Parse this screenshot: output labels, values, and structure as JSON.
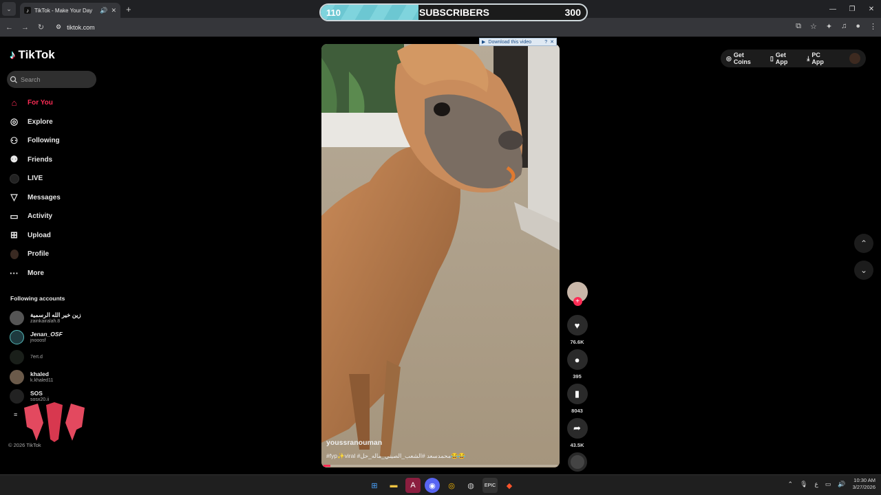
{
  "browser": {
    "tab_title": "TikTok - Make Your Day",
    "url": "tiktok.com"
  },
  "overlay": {
    "current": "110",
    "label": "SUBSCRIBERS",
    "goal": "300",
    "progress_fraction": 0.367
  },
  "sidebar": {
    "brand": "TikTok",
    "search_placeholder": "Search",
    "nav": [
      {
        "label": "For You",
        "icon": "home-icon",
        "active": true
      },
      {
        "label": "Explore",
        "icon": "compass-icon"
      },
      {
        "label": "Following",
        "icon": "following-icon"
      },
      {
        "label": "Friends",
        "icon": "friends-icon"
      },
      {
        "label": "LIVE",
        "icon": "live-icon"
      },
      {
        "label": "Messages",
        "icon": "messages-icon"
      },
      {
        "label": "Activity",
        "icon": "activity-icon"
      },
      {
        "label": "Upload",
        "icon": "upload-icon"
      },
      {
        "label": "Profile",
        "icon": "profile-icon"
      },
      {
        "label": "More",
        "icon": "more-icon"
      }
    ],
    "following_title": "Following accounts",
    "accounts": [
      {
        "name": "زين خير الله الرسمية",
        "username": "zainkairalah.8"
      },
      {
        "name": "Jenan_OSF",
        "username": "jnooosf"
      },
      {
        "name": "",
        "username": "7ert.d"
      },
      {
        "name": "khaled",
        "username": "k.khaled11"
      },
      {
        "name": "SOS",
        "username": "sosx20.ii"
      }
    ],
    "copyright": "© 2026 TikTok"
  },
  "top_actions": {
    "get_coins": "Get Coins",
    "get_app": "Get App",
    "pc_app": "PC App"
  },
  "video": {
    "download_bar": "Download this video",
    "author": "youssranouman",
    "caption": "#fyp✨viral #محمدسعد #الشعب_الصيني_ماله_حل😂😂",
    "progress_fraction": 0.03
  },
  "actions": {
    "likes": "76.6K",
    "comments": "395",
    "saves": "8043",
    "shares": "43.5K"
  },
  "taskbar": {
    "time": "10:30 AM",
    "date": "3/27/2026"
  },
  "colors": {
    "accent": "#fe2c55",
    "overlay_fill": "#7fd4dd"
  }
}
